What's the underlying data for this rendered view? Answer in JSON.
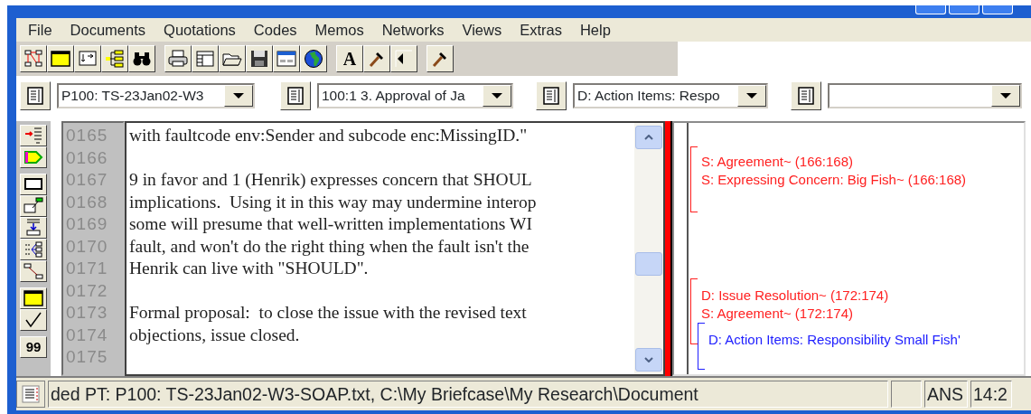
{
  "menu": [
    "File",
    "Documents",
    "Quotations",
    "Codes",
    "Memos",
    "Networks",
    "Views",
    "Extras",
    "Help"
  ],
  "toolbar": [
    {
      "kind": "graph"
    },
    {
      "kind": "window"
    },
    {
      "kind": "import"
    },
    {
      "kind": "tree"
    },
    {
      "kind": "binoculars"
    },
    {
      "kind": "gap"
    },
    {
      "kind": "printer"
    },
    {
      "kind": "table"
    },
    {
      "kind": "folder"
    },
    {
      "kind": "save"
    },
    {
      "kind": "form"
    },
    {
      "kind": "globe"
    },
    {
      "kind": "gap"
    },
    {
      "kind": "letter",
      "label": "A"
    },
    {
      "kind": "hammer"
    },
    {
      "kind": "back"
    },
    {
      "kind": "gap"
    },
    {
      "kind": "hammer"
    }
  ],
  "selectors": [
    {
      "kind": "combo",
      "value": "P100: TS-23Jan02-W3"
    },
    {
      "kind": "combo",
      "value": "100:1 3. Approval of Ja"
    },
    {
      "kind": "combo",
      "value": "D: Action Items: Respo"
    },
    {
      "kind": "combo"
    }
  ],
  "side_toolbar": [
    {
      "kind": "arrow-list"
    },
    {
      "kind": "tag"
    },
    {
      "kind": "gap"
    },
    {
      "kind": "rect"
    },
    {
      "kind": "edit"
    },
    {
      "kind": "insert"
    },
    {
      "kind": "branch"
    },
    {
      "kind": "link"
    },
    {
      "kind": "gap"
    },
    {
      "kind": "window"
    },
    {
      "kind": "check"
    },
    {
      "kind": "gap"
    },
    {
      "kind": "text",
      "label": "99"
    }
  ],
  "lines": [
    {
      "number": "0165",
      "text": "with faultcode env:Sender and subcode enc:MissingID.\""
    },
    {
      "number": "0166"
    },
    {
      "number": "0167",
      "text": "9 in favor and 1 (Henrik) expresses concern that SHOUL"
    },
    {
      "number": "0168",
      "text": "implications.  Using it in this way may undermine interop"
    },
    {
      "number": "0169",
      "text": "some will presume that well-written implementations WI"
    },
    {
      "number": "0170",
      "text": "fault, and won't do the right thing when the fault isn't the"
    },
    {
      "number": "0171",
      "text": "Henrik can live with \"SHOULD\"."
    },
    {
      "number": "0172"
    },
    {
      "number": "0173",
      "text": "Formal proposal:  to close the issue with the revised text"
    },
    {
      "number": "0174",
      "text": "objections, issue closed."
    },
    {
      "number": "0175"
    }
  ],
  "margin": [
    {
      "color": "#ff2020",
      "codes": [
        "S: Agreement~ (166:168)",
        "S: Expressing Concern: Big Fish~ (166:168)"
      ]
    },
    {
      "color": "#ff2020",
      "codes": [
        "D: Issue Resolution~ (172:174)",
        "S: Agreement~ (172:174)"
      ]
    },
    {
      "color": "#2020ff",
      "codes": [
        "D: Action Items: Responsibility Small Fish'"
      ]
    }
  ],
  "status_bar": [
    {
      "kind": "field",
      "text": "ded PT: P100: TS-23Jan02-W3-SOAP.txt, C:\\My Briefcase\\My Research\\Document"
    },
    {
      "kind": "field"
    },
    {
      "kind": "field",
      "text": "ANS"
    },
    {
      "kind": "field",
      "text": "14:2"
    }
  ]
}
